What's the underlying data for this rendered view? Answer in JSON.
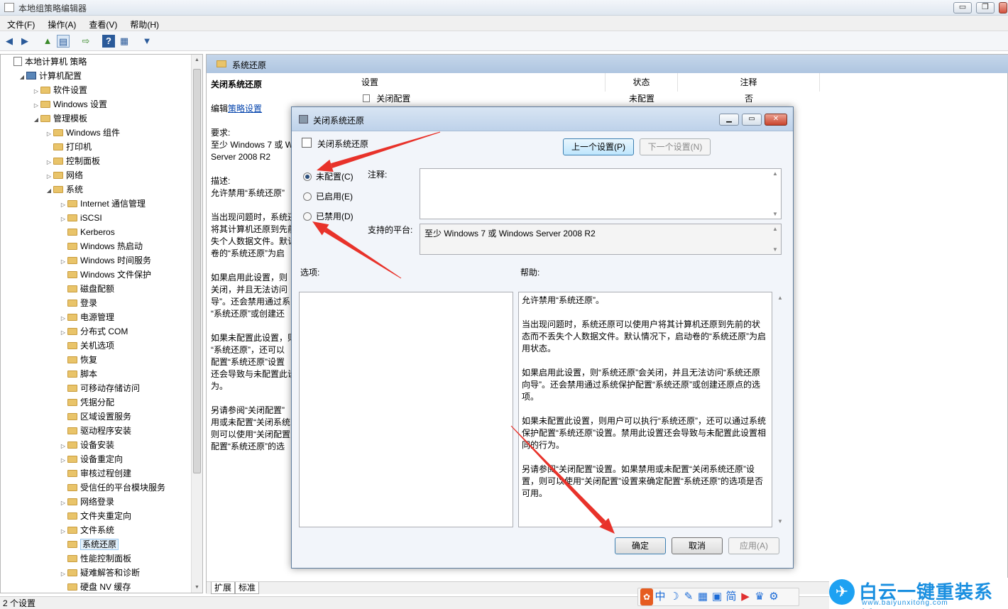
{
  "window": {
    "title": "本地组策略编辑器",
    "min": "▭",
    "max": "❐",
    "close": "✕"
  },
  "menu": [
    "文件(F)",
    "操作(A)",
    "查看(V)",
    "帮助(H)"
  ],
  "toolbar_icons": [
    "back-arrow-icon",
    "forward-arrow-icon",
    "up-folder-icon",
    "show-tree-icon",
    "export-icon",
    "help-icon",
    "properties-icon",
    "filter-icon"
  ],
  "tree": [
    {
      "label": "本地计算机 策略",
      "icon": "doc"
    },
    {
      "label": "计算机配置",
      "icon": "pc"
    },
    {
      "label": "软件设置",
      "icon": "fold"
    },
    {
      "label": "Windows 设置",
      "icon": "fold"
    },
    {
      "label": "管理模板",
      "icon": "fold"
    },
    {
      "label": "Windows 组件",
      "icon": "fold"
    },
    {
      "label": "打印机",
      "icon": "fold"
    },
    {
      "label": "控制面板",
      "icon": "fold"
    },
    {
      "label": "网络",
      "icon": "fold"
    },
    {
      "label": "系统",
      "icon": "fold"
    },
    {
      "label": "Internet 通信管理",
      "icon": "fold"
    },
    {
      "label": "iSCSI",
      "icon": "fold"
    },
    {
      "label": "Kerberos",
      "icon": "fold"
    },
    {
      "label": "Windows 热启动",
      "icon": "fold"
    },
    {
      "label": "Windows 时间服务",
      "icon": "fold"
    },
    {
      "label": "Windows 文件保护",
      "icon": "fold"
    },
    {
      "label": "磁盘配额",
      "icon": "fold"
    },
    {
      "label": "登录",
      "icon": "fold"
    },
    {
      "label": "电源管理",
      "icon": "fold"
    },
    {
      "label": "分布式 COM",
      "icon": "fold"
    },
    {
      "label": "关机选项",
      "icon": "fold"
    },
    {
      "label": "恢复",
      "icon": "fold"
    },
    {
      "label": "脚本",
      "icon": "fold"
    },
    {
      "label": "可移动存储访问",
      "icon": "fold"
    },
    {
      "label": "凭据分配",
      "icon": "fold"
    },
    {
      "label": "区域设置服务",
      "icon": "fold"
    },
    {
      "label": "驱动程序安装",
      "icon": "fold"
    },
    {
      "label": "设备安装",
      "icon": "fold"
    },
    {
      "label": "设备重定向",
      "icon": "fold"
    },
    {
      "label": "审核过程创建",
      "icon": "fold"
    },
    {
      "label": "受信任的平台模块服务",
      "icon": "fold"
    },
    {
      "label": "网络登录",
      "icon": "fold"
    },
    {
      "label": "文件夹重定向",
      "icon": "fold"
    },
    {
      "label": "文件系统",
      "icon": "fold"
    },
    {
      "label": "系统还原",
      "icon": "fold"
    },
    {
      "label": "性能控制面板",
      "icon": "fold"
    },
    {
      "label": "疑难解答和诊断",
      "icon": "fold"
    },
    {
      "label": "硬盘 NV 缓存",
      "icon": "fold"
    }
  ],
  "right": {
    "header": "系统还原",
    "desc_title": "关闭系统还原",
    "edit_prefix": "编辑",
    "edit_link": "策略设置",
    "req_label": "要求:",
    "req_line1": "至少 Windows 7 或 W",
    "req_line2": "Server 2008 R2",
    "desc_label": "描述:",
    "desc_line1": "允许禁用“系统还原”",
    "para1": [
      "当出现问题时，系统还",
      "将其计算机还原到先前",
      "失个人数据文件。默认",
      "卷的“系统还原”为启"
    ],
    "para2": [
      "如果启用此设置，则",
      "关闭，并且无法访问",
      "导”。还会禁用通过系",
      "“系统还原”或创建还"
    ],
    "para3": [
      "如果未配置此设置，则",
      "“系统还原”，还可以",
      "配置“系统还原”设置",
      "还会导致与未配置此设",
      "为。"
    ],
    "para4": [
      "另请参阅“关闭配置”",
      "用或未配置“关闭系统",
      "则可以使用“关闭配置",
      "配置“系统还原”的选"
    ],
    "columns": {
      "setting": "设置",
      "state": "状态",
      "note": "注释"
    },
    "row": {
      "name": "关闭配置",
      "state": "未配置",
      "note": "否"
    },
    "tabs": [
      "扩展",
      "标准"
    ]
  },
  "status": "2 个设置",
  "dialog": {
    "title": "关闭系统还原",
    "subtitle": "关闭系统还原",
    "prev": "上一个设置(P)",
    "next": "下一个设置(N)",
    "radios": [
      "未配置(C)",
      "已启用(E)",
      "已禁用(D)"
    ],
    "comment_label": "注释:",
    "platform_label": "支持的平台:",
    "platform_value": "至少 Windows 7 或 Windows Server 2008 R2",
    "options_label": "选项:",
    "help_label": "帮助:",
    "help": [
      "允许禁用“系统还原”。",
      "当出现问题时，系统还原可以使用户将其计算机还原到先前的状态而不丢失个人数据文件。默认情况下，启动卷的“系统还原”为启用状态。",
      "如果启用此设置，则“系统还原”会关闭，并且无法访问“系统还原向导”。还会禁用通过系统保护配置“系统还原”或创建还原点的选项。",
      "如果未配置此设置，则用户可以执行“系统还原”，还可以通过系统保护配置“系统还原”设置。禁用此设置还会导致与未配置此设置相同的行为。",
      "另请参阅“关闭配置”设置。如果禁用或未配置“关闭系统还原”设置，则可以使用“关闭配置”设置来确定配置“系统还原”的选项是否可用。"
    ],
    "ok": "确定",
    "cancel": "取消",
    "apply": "应用(A)"
  },
  "ime": [
    "中",
    "☽",
    "✎",
    "▦",
    "▣",
    "简",
    "▶",
    "♛",
    "⚙"
  ],
  "watermark": {
    "title": "白云一键重装系统",
    "url": "www.baiyunxitong.com"
  },
  "annotation_color": "#e8322a"
}
